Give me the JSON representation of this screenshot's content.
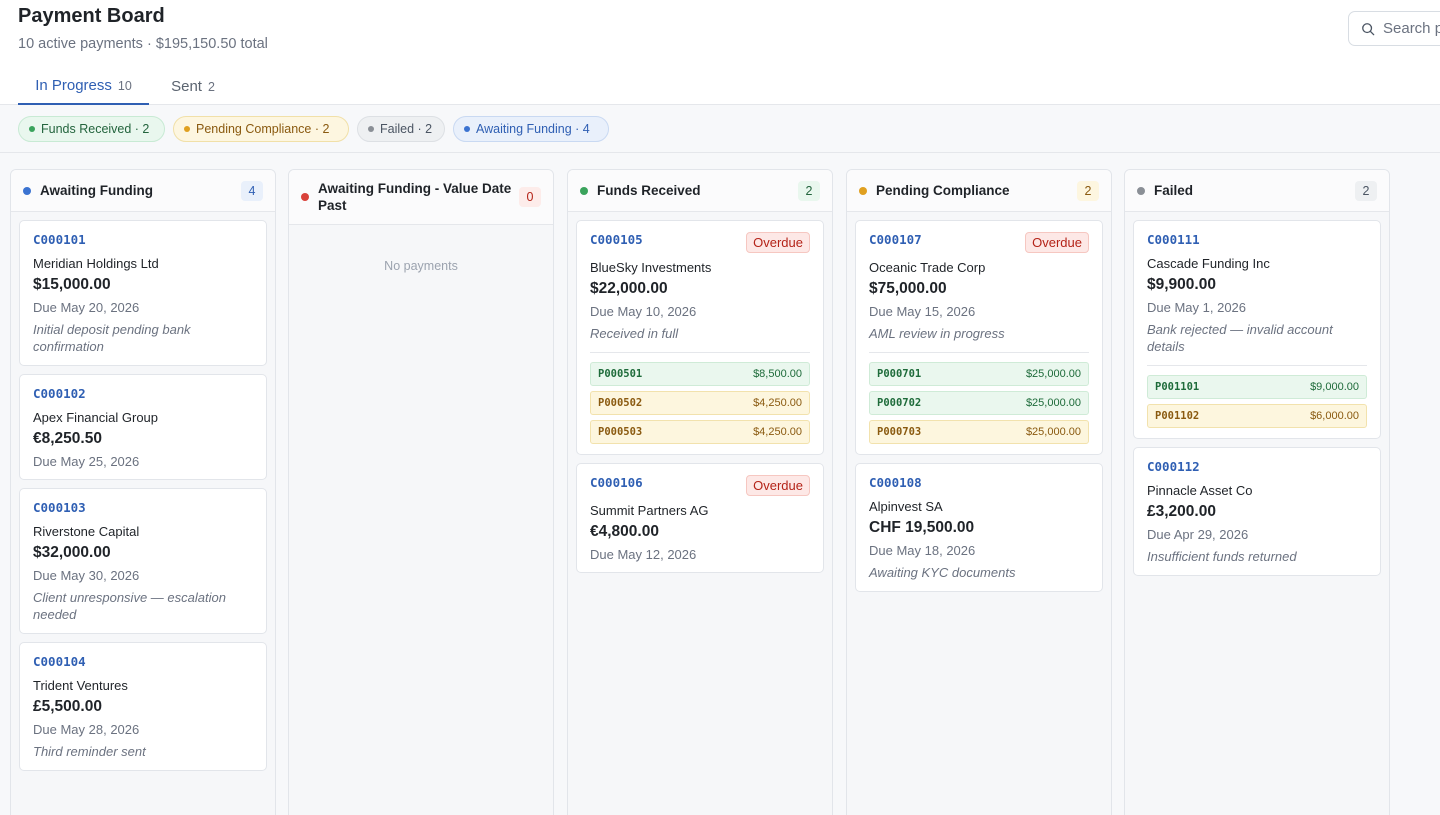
{
  "header": {
    "title": "Payment Board",
    "subtitle": "10 active payments · $195,150.50 total",
    "search_placeholder": "Search payments"
  },
  "tabs": [
    {
      "label": "In Progress",
      "count": "10",
      "active": true
    },
    {
      "label": "Sent",
      "count": "2",
      "active": false
    }
  ],
  "filters": [
    {
      "label": "Funds Received · 2",
      "color": "#3aa35c"
    },
    {
      "label": "Pending Compliance · 2",
      "color": "#e0a020"
    },
    {
      "label": "Failed · 2",
      "color": "#8a8f96"
    },
    {
      "label": "Awaiting Funding · 4",
      "color": "#3b73d1"
    }
  ],
  "columns": [
    {
      "title": "Awaiting Funding",
      "count": "4",
      "color": "#3b73d1",
      "cards": [
        {
          "id": "C000101",
          "name": "Meridian Holdings Ltd",
          "amount": "$15,000.00",
          "due": "Due May 20, 2026",
          "note": "Initial deposit pending bank confirmation"
        },
        {
          "id": "C000102",
          "name": "Apex Financial Group",
          "amount": "€8,250.50",
          "due": "Due May 25, 2026"
        },
        {
          "id": "C000103",
          "name": "Riverstone Capital",
          "amount": "$32,000.00",
          "due": "Due May 30, 2026",
          "note": "Client unresponsive — escalation needed"
        },
        {
          "id": "C000104",
          "name": "Trident Ventures",
          "amount": "£5,500.00",
          "due": "Due May 28, 2026",
          "note": "Third reminder sent"
        }
      ]
    },
    {
      "title": "Awaiting Funding - Value Date Past",
      "count": "0",
      "color": "#d9423a",
      "empty_text": "No payments"
    },
    {
      "title": "Funds Received",
      "count": "2",
      "color": "#3aa35c",
      "cards": [
        {
          "id": "C000105",
          "badge": "Overdue",
          "name": "BlueSky Investments",
          "amount": "$22,000.00",
          "due": "Due May 10, 2026",
          "note": "Received in full",
          "sub": [
            {
              "id": "P000501",
              "amount": "$8,500.00",
              "status": "green"
            },
            {
              "id": "P000502",
              "amount": "$4,250.00",
              "status": "yellow"
            },
            {
              "id": "P000503",
              "amount": "$4,250.00",
              "status": "yellow"
            }
          ]
        },
        {
          "id": "C000106",
          "badge": "Overdue",
          "name": "Summit Partners AG",
          "amount": "€4,800.00",
          "due": "Due May 12, 2026"
        }
      ]
    },
    {
      "title": "Pending Compliance",
      "count": "2",
      "color": "#e0a020",
      "cards": [
        {
          "id": "C000107",
          "badge": "Overdue",
          "name": "Oceanic Trade Corp",
          "amount": "$75,000.00",
          "due": "Due May 15, 2026",
          "note": "AML review in progress",
          "sub": [
            {
              "id": "P000701",
              "amount": "$25,000.00",
              "status": "green"
            },
            {
              "id": "P000702",
              "amount": "$25,000.00",
              "status": "green"
            },
            {
              "id": "P000703",
              "amount": "$25,000.00",
              "status": "yellow"
            }
          ]
        },
        {
          "id": "C000108",
          "name": "Alpinvest SA",
          "amount": "CHF 19,500.00",
          "due": "Due May 18, 2026",
          "note": "Awaiting KYC documents"
        }
      ]
    },
    {
      "title": "Failed",
      "count": "2",
      "color": "#8a8f96",
      "cards": [
        {
          "id": "C000111",
          "name": "Cascade Funding Inc",
          "amount": "$9,900.00",
          "due": "Due May 1, 2026",
          "note": "Bank rejected — invalid account details",
          "sub": [
            {
              "id": "P001101",
              "amount": "$9,000.00",
              "status": "green"
            },
            {
              "id": "P001102",
              "amount": "$6,000.00",
              "status": "yellow"
            }
          ]
        },
        {
          "id": "C000112",
          "name": "Pinnacle Asset Co",
          "amount": "£3,200.00",
          "due": "Due Apr 29, 2026",
          "note": "Insufficient funds returned"
        }
      ]
    }
  ]
}
